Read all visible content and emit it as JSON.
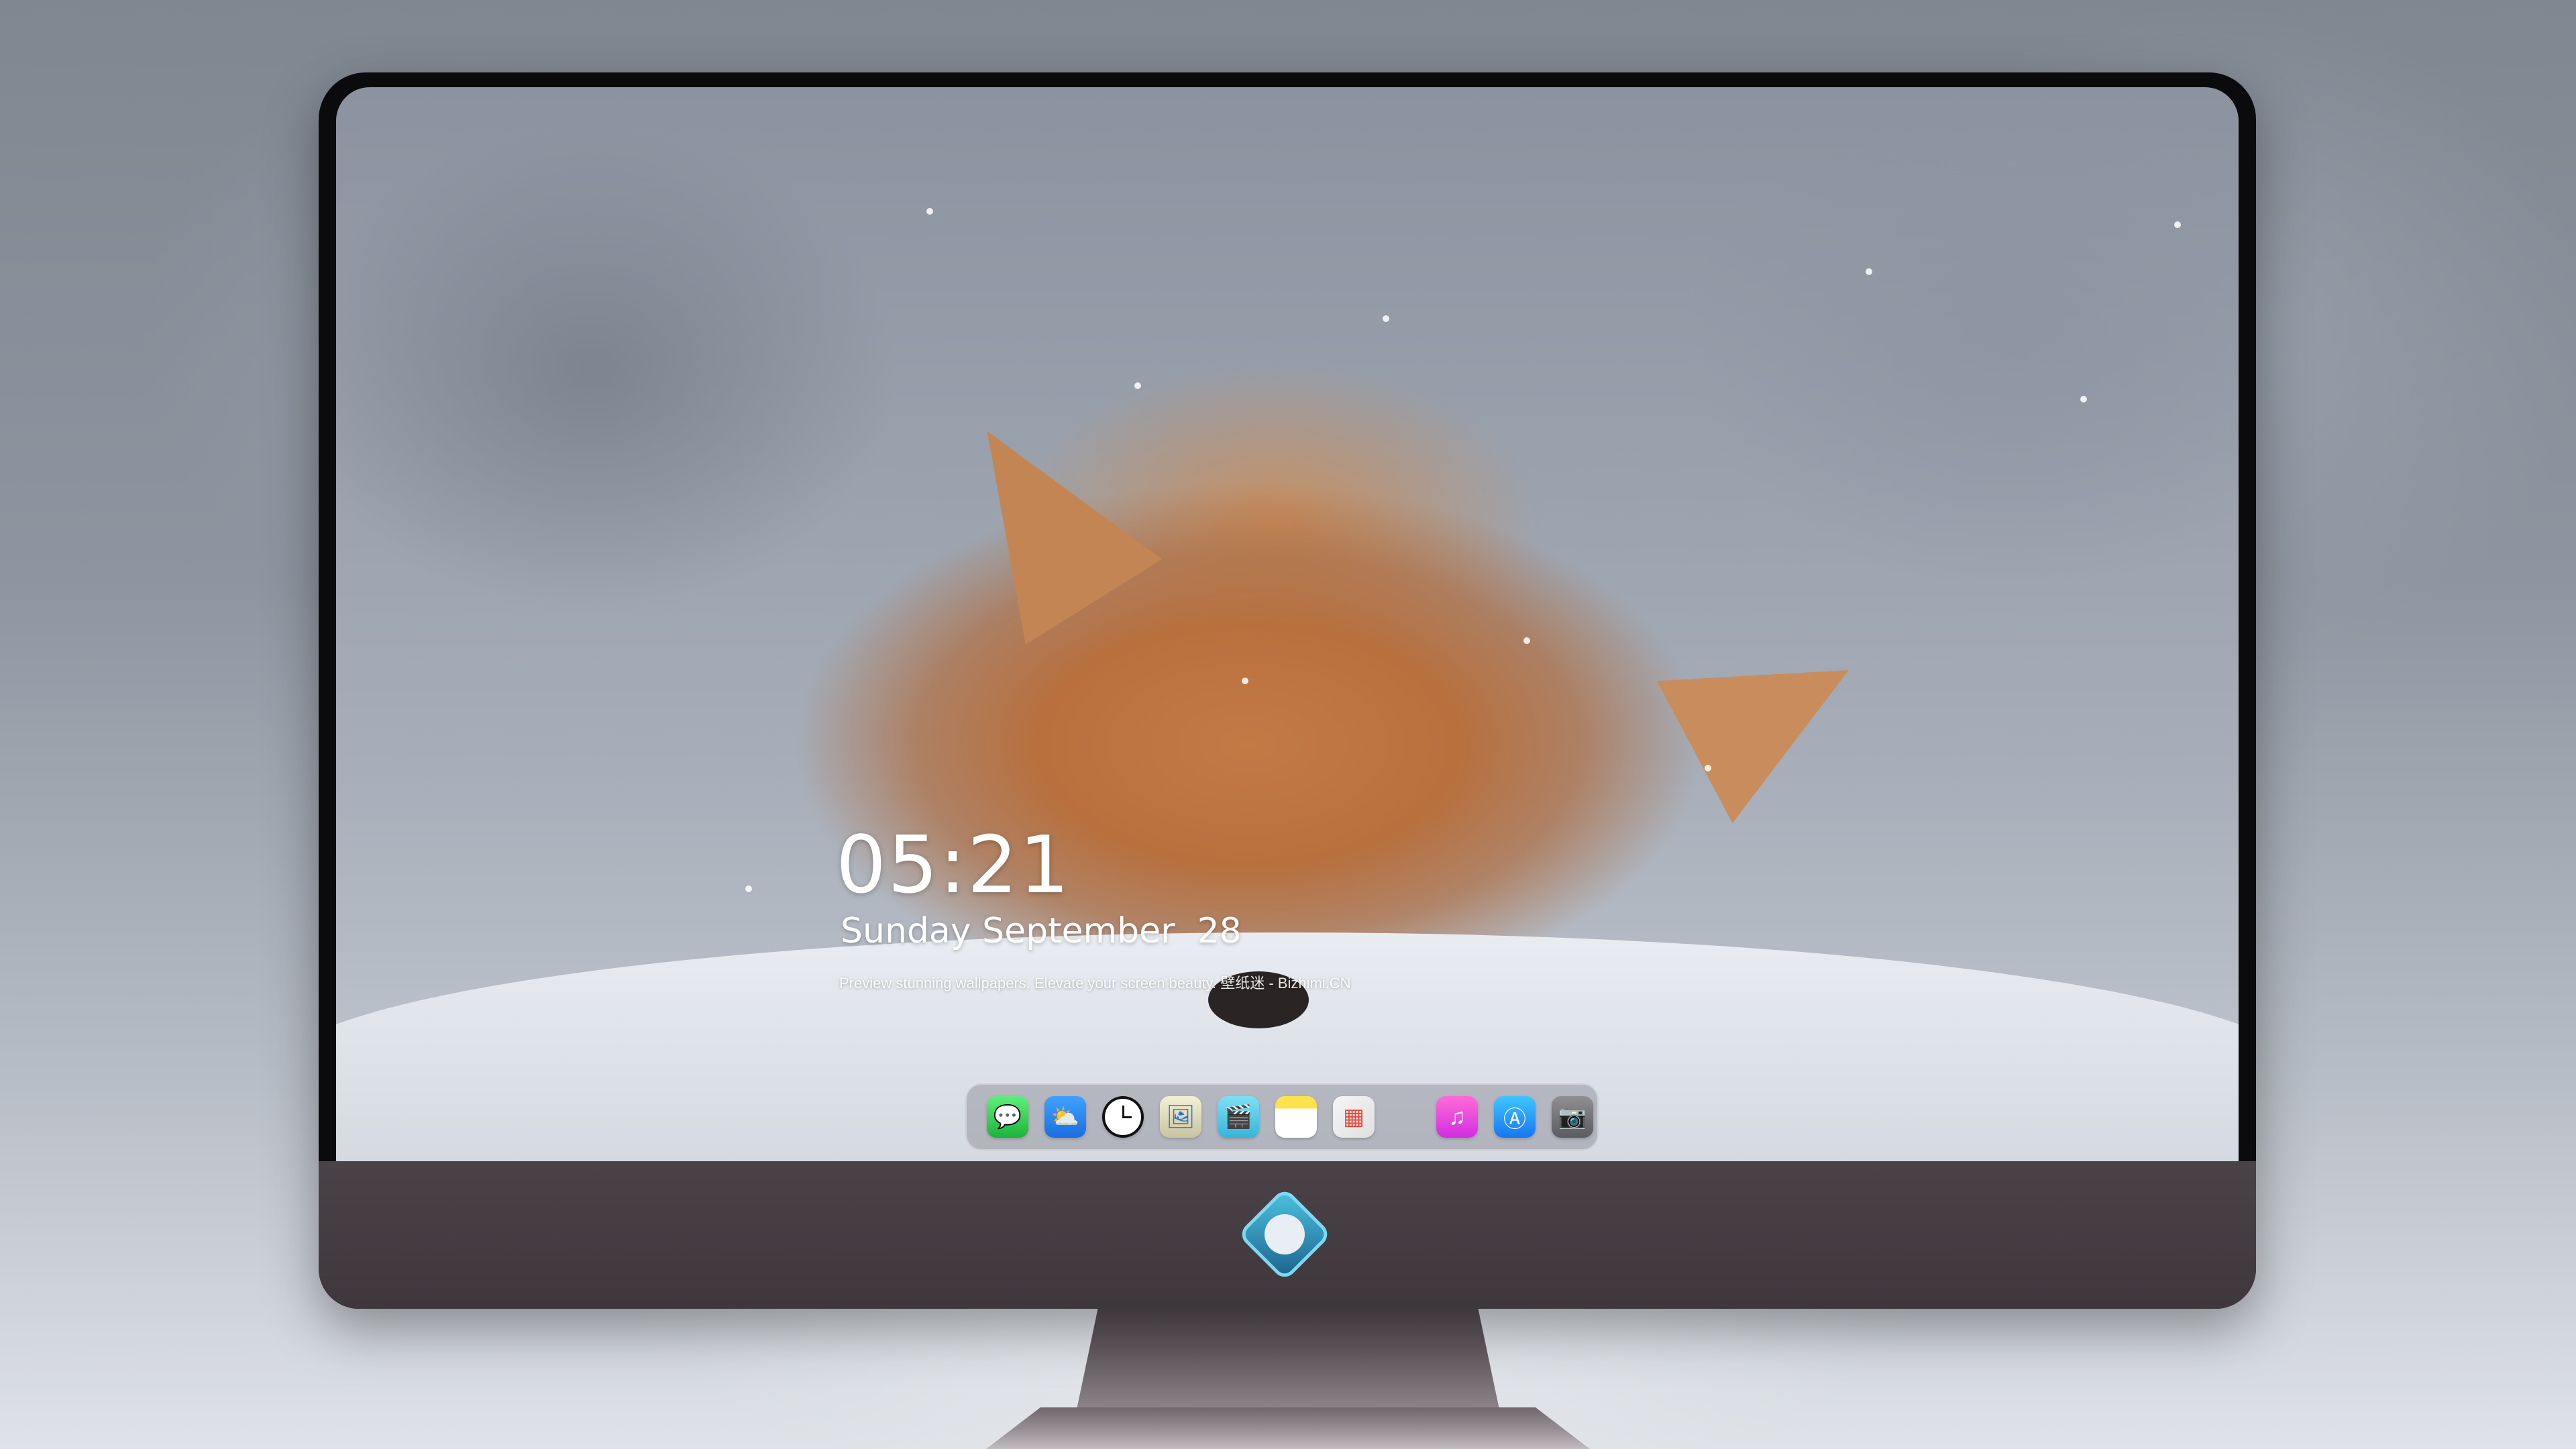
{
  "lock_screen": {
    "time": "05:21",
    "date": "Sunday September  28",
    "tagline": "Preview stunning wallpapers. Elevate your screen beauty. 壁纸迷 - Bizhimi.CN"
  },
  "dock": {
    "apps": [
      {
        "name": "Messages",
        "icon": "message-bubble-icon",
        "glyph": "💬"
      },
      {
        "name": "Weather",
        "icon": "cloud-sun-icon",
        "glyph": "⛅"
      },
      {
        "name": "Clock",
        "icon": "clock-icon",
        "glyph": ""
      },
      {
        "name": "Preview",
        "icon": "preview-icon",
        "glyph": "🖼"
      },
      {
        "name": "Clips",
        "icon": "clapperboard-icon",
        "glyph": "🎬"
      },
      {
        "name": "Notes",
        "icon": "notes-icon",
        "glyph": ""
      },
      {
        "name": "Photo Booth",
        "icon": "photos-icon",
        "glyph": "▦"
      },
      {
        "name": "Music",
        "icon": "music-note-icon",
        "glyph": "♫"
      },
      {
        "name": "App Store",
        "icon": "app-store-icon",
        "glyph": "Ⓐ"
      },
      {
        "name": "Camera",
        "icon": "camera-icon",
        "glyph": "📷"
      }
    ]
  },
  "colors": {
    "monitor_bezel": "#0b0b0d",
    "monitor_chin": "#4a4247",
    "fox_fur": "#c37a45",
    "snow": "#e9ecf1"
  }
}
